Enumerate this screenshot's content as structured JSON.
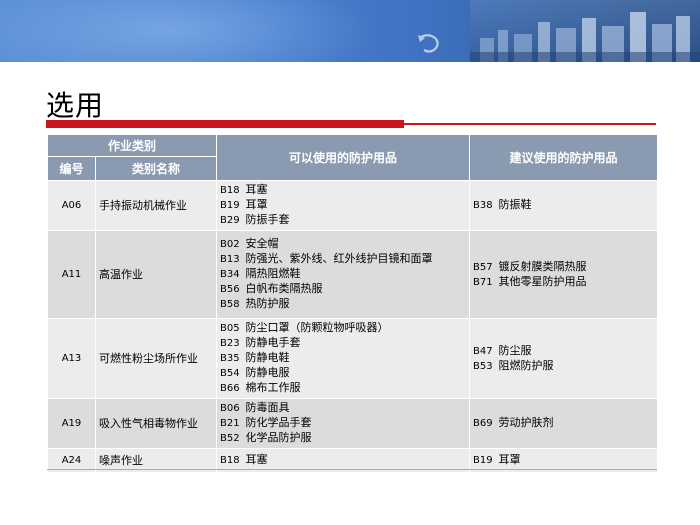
{
  "page": {
    "title": "选用"
  },
  "table": {
    "group_header": "作业类别",
    "col_code": "编号",
    "col_name": "类别名称",
    "col_usable": "可以使用的防护用品",
    "col_suggested": "建议使用的防护用品",
    "rows": [
      {
        "code": "A06",
        "name": "手持振动机械作业",
        "usable": [
          {
            "code": "B18",
            "label": "耳塞"
          },
          {
            "code": "B19",
            "label": "耳罩"
          },
          {
            "code": "B29",
            "label": "防振手套"
          }
        ],
        "suggested": [
          {
            "code": "B38",
            "label": "防振鞋"
          }
        ]
      },
      {
        "code": "A11",
        "name": "高温作业",
        "usable": [
          {
            "code": "B02",
            "label": "安全帽"
          },
          {
            "code": "B13",
            "label": "防强光、紫外线、红外线护目镜和面罩"
          },
          {
            "code": "B34",
            "label": "隔热阻燃鞋"
          },
          {
            "code": "B56",
            "label": "白帆布类隔热服"
          },
          {
            "code": "B58",
            "label": "热防护服"
          }
        ],
        "suggested": [
          {
            "code": "B57",
            "label": "镀反射膜类隔热服"
          },
          {
            "code": "B71",
            "label": "其他零星防护用品"
          }
        ]
      },
      {
        "code": "A13",
        "name": "可燃性粉尘场所作业",
        "usable": [
          {
            "code": "B05",
            "label": "防尘口罩（防颗粒物呼吸器）"
          },
          {
            "code": "B23",
            "label": "防静电手套"
          },
          {
            "code": "B35",
            "label": "防静电鞋"
          },
          {
            "code": "B54",
            "label": "防静电服"
          },
          {
            "code": "B66",
            "label": "棉布工作服"
          }
        ],
        "suggested": [
          {
            "code": "B47",
            "label": "防尘服"
          },
          {
            "code": "B53",
            "label": "阻燃防护服"
          }
        ]
      },
      {
        "code": "A19",
        "name": "吸入性气相毒物作业",
        "usable": [
          {
            "code": "B06",
            "label": "防毒面具"
          },
          {
            "code": "B21",
            "label": "防化学品手套"
          },
          {
            "code": "B52",
            "label": "化学品防护服"
          }
        ],
        "suggested": [
          {
            "code": "B69",
            "label": "劳动护肤剂"
          }
        ]
      },
      {
        "code": "A24",
        "name": "噪声作业",
        "usable": [
          {
            "code": "B18",
            "label": "耳塞"
          }
        ],
        "suggested": [
          {
            "code": "B19",
            "label": "耳罩"
          }
        ]
      }
    ]
  },
  "colors": {
    "header": "#8a9bb1",
    "accent": "#c8161d",
    "banner": "#4a80cf"
  }
}
